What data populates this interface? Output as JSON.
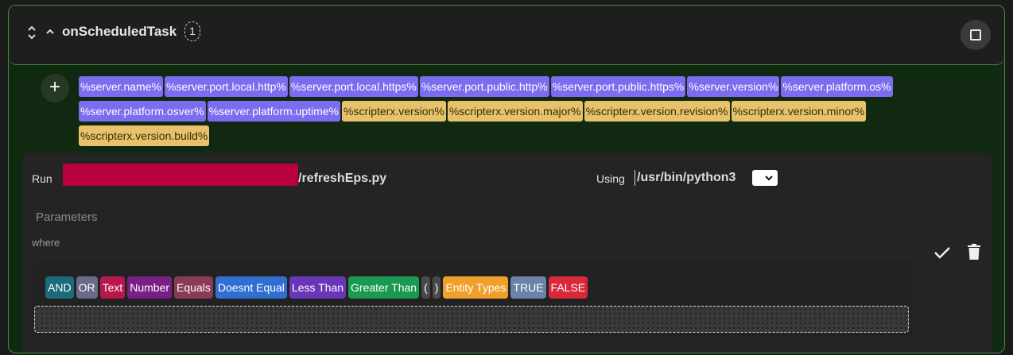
{
  "header": {
    "title": "onScheduledTask",
    "count": "1",
    "icons": {
      "sort": "sort-icon",
      "collapse": "chevron-up-icon",
      "square": "square-icon"
    }
  },
  "add_button_label": "+",
  "variables": [
    {
      "label": "%server.name%",
      "group": "server"
    },
    {
      "label": "%server.port.local.http%",
      "group": "server"
    },
    {
      "label": "%server.port.local.https%",
      "group": "server"
    },
    {
      "label": "%server.port.public.http%",
      "group": "server"
    },
    {
      "label": "%server.port.public.https%",
      "group": "server"
    },
    {
      "label": "%server.version%",
      "group": "server"
    },
    {
      "label": "%server.platform.os%",
      "group": "server"
    },
    {
      "label": "%server.platform.osver%",
      "group": "server"
    },
    {
      "label": "%server.platform.uptime%",
      "group": "server"
    },
    {
      "label": "%scripterx.version%",
      "group": "scriptx"
    },
    {
      "label": "%scripterx.version.major%",
      "group": "scriptx"
    },
    {
      "label": "%scripterx.version.revision%",
      "group": "scriptx"
    },
    {
      "label": "%scripterx.version.minor%",
      "group": "scriptx"
    },
    {
      "label": "%scripterx.version.build%",
      "group": "scriptx"
    }
  ],
  "run": {
    "label": "Run",
    "script_suffix": "/refreshEps.py",
    "using_label": "Using",
    "interpreter": "/usr/bin/python3",
    "parameters_placeholder": "Parameters",
    "where_label": "where"
  },
  "tokens": [
    {
      "label": "AND",
      "color": "#1a6b7c"
    },
    {
      "label": "OR",
      "color": "#6a6a8a"
    },
    {
      "label": "Text",
      "color": "#b8174d"
    },
    {
      "label": "Number",
      "color": "#7a1f86"
    },
    {
      "label": "Equals",
      "color": "#8a3a56"
    },
    {
      "label": "Doesnt Equal",
      "color": "#2f6fd0"
    },
    {
      "label": "Less Than",
      "color": "#6a36b8"
    },
    {
      "label": "Greater Than",
      "color": "#1a9a50"
    },
    {
      "label": "(",
      "color": "#4a4a4a"
    },
    {
      "label": ")",
      "color": "#4a4a4a"
    },
    {
      "label": "Entity Types",
      "color": "#f0a02a"
    },
    {
      "label": "TRUE",
      "color": "#6a84a8"
    },
    {
      "label": "FALSE",
      "color": "#d8283a"
    }
  ],
  "colors": {
    "accent_green": "#3f8f3f",
    "server_var": "#7b6cf0",
    "scripterx_var": "#e6c26a",
    "redaction": "#b7003d"
  }
}
